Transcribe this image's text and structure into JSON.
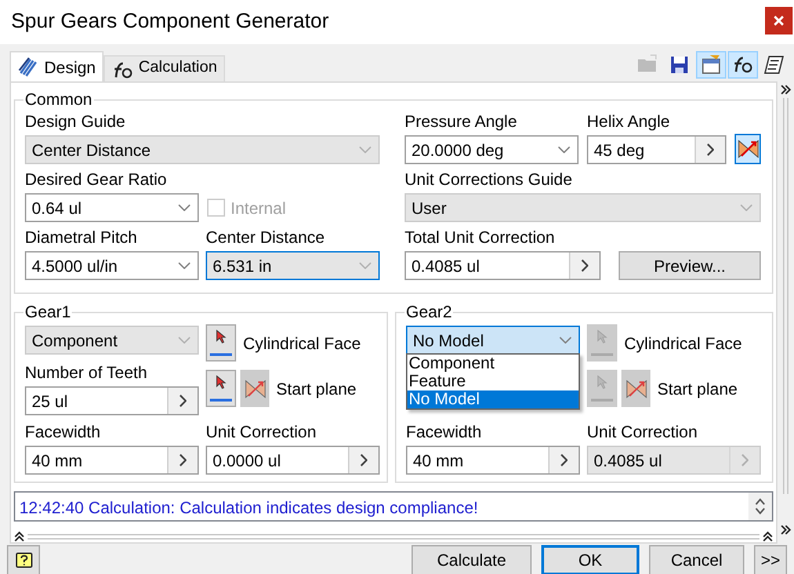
{
  "window": {
    "title": "Spur Gears Component Generator"
  },
  "tabs": [
    {
      "kind": "design",
      "label": "Design",
      "selected": true
    },
    {
      "kind": "calculation",
      "label": "Calculation",
      "selected": false
    }
  ],
  "toolbar": [
    {
      "kind": "folder",
      "pressed": false,
      "disabled": true
    },
    {
      "kind": "save",
      "pressed": false,
      "disabled": false
    },
    {
      "kind": "settings",
      "pressed": true,
      "disabled": false
    },
    {
      "kind": "fx",
      "pressed": true,
      "disabled": false
    },
    {
      "kind": "notes",
      "pressed": false,
      "disabled": false
    }
  ],
  "common": {
    "title": "Common",
    "design_guide": {
      "label": "Design Guide",
      "value": "Center Distance",
      "kind": "combo",
      "disabled": true,
      "focused": false
    },
    "gear_ratio": {
      "label": "Desired Gear Ratio",
      "value": "0.64 ul",
      "kind": "combo",
      "disabled": false,
      "focused": false
    },
    "internal": {
      "label": "Internal",
      "checked": false,
      "disabled": true
    },
    "diametral_pitch": {
      "label": "Diametral Pitch",
      "value": "4.5000 ul/in",
      "kind": "combo",
      "disabled": false,
      "focused": false
    },
    "center_distance": {
      "label": "Center Distance",
      "value": "6.531 in",
      "kind": "combo",
      "disabled": true,
      "focused": true
    },
    "pressure_angle": {
      "label": "Pressure Angle",
      "value": "20.0000 deg",
      "kind": "combo",
      "disabled": false,
      "focused": false
    },
    "helix_angle": {
      "label": "Helix Angle",
      "value": "45 deg",
      "kind": "spin",
      "disabled": false,
      "focused": false
    },
    "helix_button": {
      "pressed": true
    },
    "corrections_guide": {
      "label": "Unit Corrections Guide",
      "value": "User",
      "kind": "combo",
      "disabled": true,
      "focused": false
    },
    "total_correction": {
      "label": "Total Unit Correction",
      "value": "0.4085 ul",
      "kind": "spin",
      "disabled": false,
      "focused": false
    },
    "preview_button": {
      "label": "Preview..."
    }
  },
  "gears": [
    {
      "title": "Gear1",
      "model": {
        "value": "Component",
        "kind": "combo",
        "disabled": true,
        "focused": false,
        "open": false
      },
      "cylindrical_face": {
        "label": "Cylindrical Face",
        "enabled": true
      },
      "number_of_teeth": {
        "label": "Number of Teeth",
        "value": "25 ul",
        "kind": "spin",
        "disabled": false,
        "focused": false
      },
      "start_plane": {
        "label": "Start plane",
        "enabled": true
      },
      "facewidth": {
        "label": "Facewidth",
        "value": "40 mm",
        "kind": "spin",
        "disabled": false,
        "focused": false
      },
      "unit_correction": {
        "label": "Unit Correction",
        "value": "0.0000 ul",
        "kind": "spin",
        "disabled": false,
        "focused": false
      }
    },
    {
      "title": "Gear2",
      "model": {
        "value": "No Model",
        "kind": "combo",
        "disabled": false,
        "focused": true,
        "open": true,
        "options": [
          {
            "label": "Component",
            "selected": false
          },
          {
            "label": "Feature",
            "selected": false
          },
          {
            "label": "No Model",
            "selected": true
          }
        ]
      },
      "cylindrical_face": {
        "label": "Cylindrical Face",
        "enabled": false
      },
      "start_plane": {
        "label": "Start plane",
        "enabled": false
      },
      "facewidth": {
        "label": "Facewidth",
        "value": "40 mm",
        "kind": "spin",
        "disabled": false,
        "focused": false
      },
      "unit_correction": {
        "label": "Unit Correction",
        "value": "0.4085 ul",
        "kind": "spin",
        "disabled": true,
        "focused": false
      }
    }
  ],
  "messages": [
    "12:42:40 Calculation: Calculation indicates design compliance!"
  ],
  "buttons": [
    {
      "label": "Calculate",
      "default": false
    },
    {
      "label": "OK",
      "default": true
    },
    {
      "label": "Cancel",
      "default": false
    },
    {
      "label": ">>",
      "default": false
    }
  ]
}
